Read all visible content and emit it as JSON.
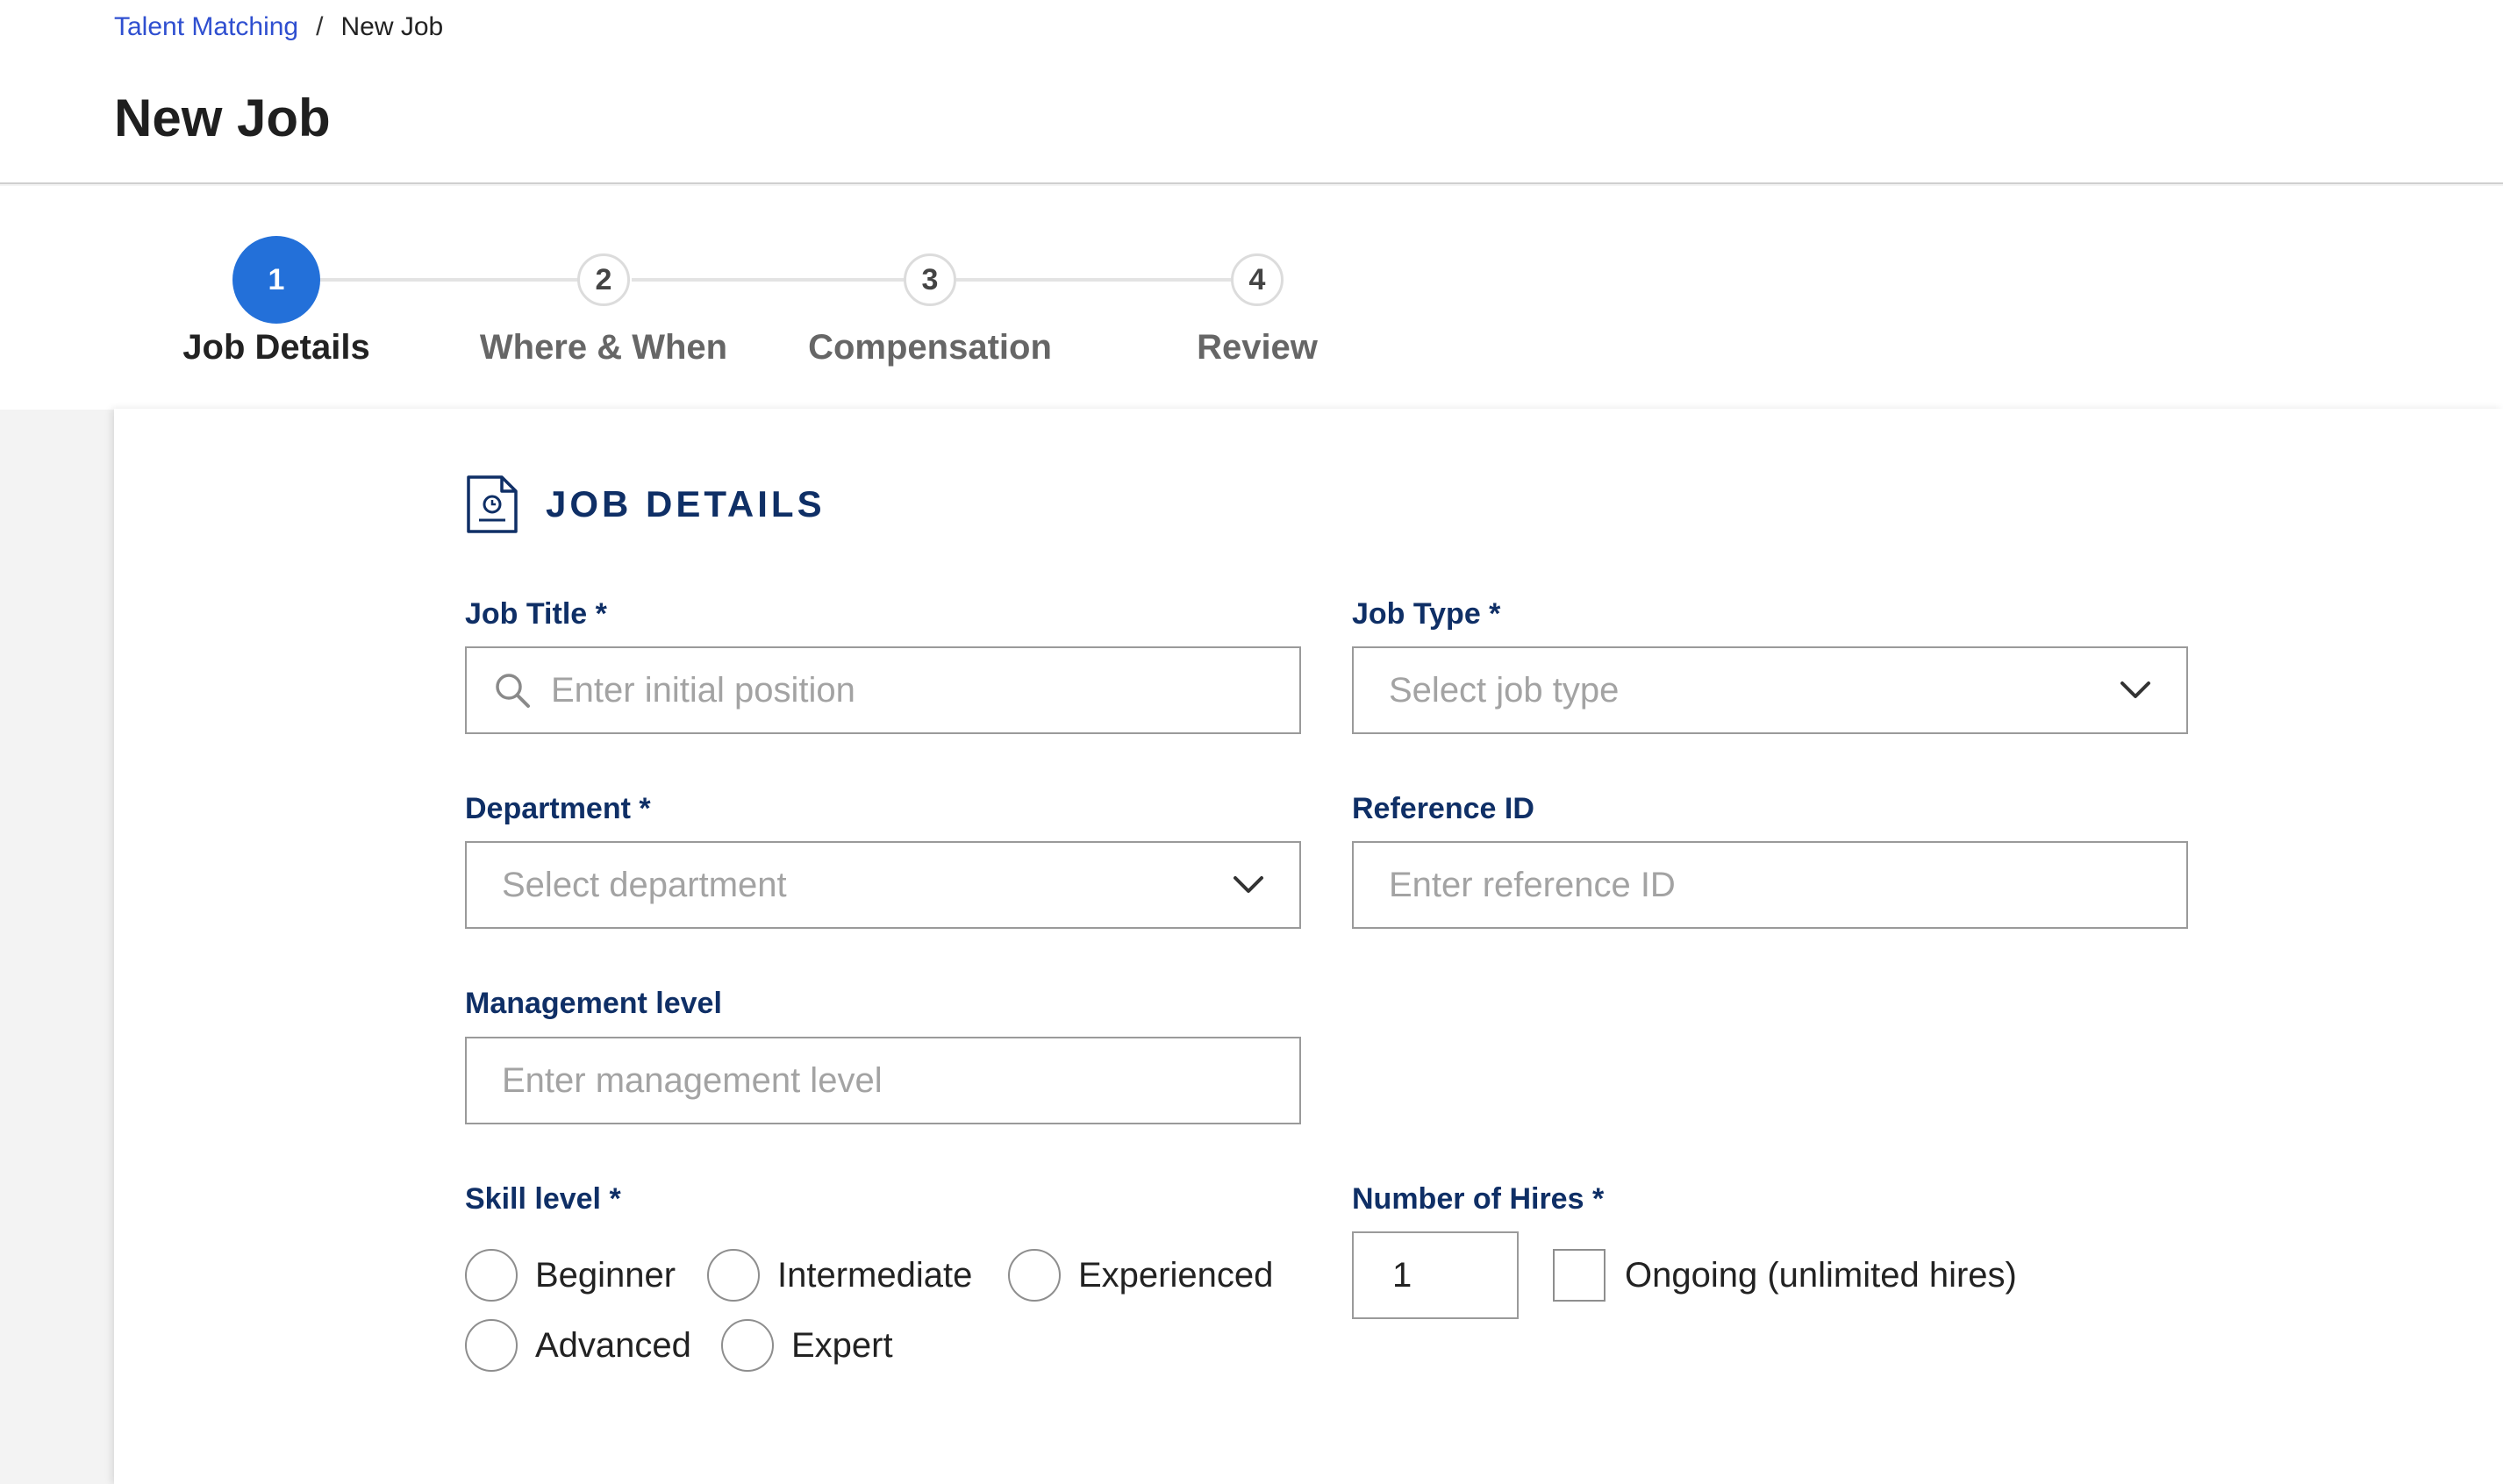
{
  "breadcrumb": {
    "parent": "Talent Matching",
    "separator": "/",
    "current": "New Job"
  },
  "page": {
    "title": "New Job"
  },
  "stepper": {
    "steps": [
      {
        "number": "1",
        "label": "Job Details",
        "active": true
      },
      {
        "number": "2",
        "label": "Where & When",
        "active": false
      },
      {
        "number": "3",
        "label": "Compensation",
        "active": false
      },
      {
        "number": "4",
        "label": "Review",
        "active": false
      }
    ]
  },
  "section": {
    "title": "JOB DETAILS",
    "icon": "document-clock-icon"
  },
  "form": {
    "job_title": {
      "label": "Job Title *",
      "placeholder": "Enter initial position",
      "icon": "search-icon"
    },
    "job_type": {
      "label": "Job Type *",
      "placeholder": "Select job type"
    },
    "department": {
      "label": "Department *",
      "placeholder": "Select department"
    },
    "reference_id": {
      "label": "Reference ID",
      "placeholder": "Enter reference ID"
    },
    "management_level": {
      "label": "Management level",
      "placeholder": "Enter management level"
    },
    "skill_level": {
      "label": "Skill level *",
      "options": [
        "Beginner",
        "Intermediate",
        "Experienced",
        "Advanced",
        "Expert"
      ]
    },
    "hires": {
      "label": "Number of Hires *",
      "value": "1",
      "ongoing_label": "Ongoing (unlimited hires)"
    }
  },
  "colors": {
    "accent": "#2370d9",
    "label": "#0f2f66",
    "link": "#2f4fd0"
  }
}
